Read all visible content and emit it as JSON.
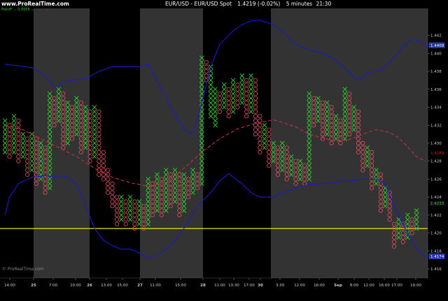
{
  "header": {
    "brand": "www.ProRealTime.com",
    "title": "EUR/USD - EUR/USD Spot",
    "price": "1.4219 (-0.02%)",
    "interval": "5 minutes",
    "time": "21:30"
  },
  "legend": {
    "line1": "PointF ... 0.0005 ...",
    "line2": "...",
    "line3": "..."
  },
  "watermark": "© ProRealTime.com",
  "colors": {
    "background": "#000000",
    "session_band": "#333333",
    "x_mark": "#33cc33",
    "o_mark": "#e05060",
    "upper_band": "#1a1acc",
    "lower_band": "#1a1acc",
    "middle_line": "#c03040",
    "level_line": "#e8e000",
    "axis_text": "#cccccc",
    "current_price_label": "#cc2222"
  },
  "chart_data": {
    "type": "point-and-figure",
    "symbol": "EUR/USD",
    "box_size": 0.0005,
    "ylim": [
      1.415,
      1.445
    ],
    "y_ticks": [
      "1.442",
      "1.440",
      "1.438",
      "1.436",
      "1.434",
      "1.432",
      "1.430",
      "1.428",
      "1.426",
      "1.424",
      "1.422",
      "1.420",
      "1.418",
      "1.416"
    ],
    "x_labels": [
      "14:00",
      "25",
      "7:00",
      "10:00",
      "26",
      "13:00",
      "15:00",
      "27",
      "11:00",
      "15:00",
      "28",
      "11:00",
      "13:30",
      "17:00",
      "30",
      "3:30",
      "12:00",
      "16:00",
      "Sep",
      "8:00",
      "12:00",
      "16:00",
      "17:00",
      "19:00"
    ],
    "horizontal_level": 1.4205,
    "price_labels": {
      "upper": "1.4409",
      "middle": "1.4289",
      "lower_mid": "1.4233",
      "lower": "1.4174"
    },
    "columns": [
      {
        "type": "X",
        "low": 1.429,
        "high": 1.4325
      },
      {
        "type": "O",
        "low": 1.4285,
        "high": 1.432
      },
      {
        "type": "X",
        "low": 1.429,
        "high": 1.433
      },
      {
        "type": "O",
        "low": 1.428,
        "high": 1.4325
      },
      {
        "type": "X",
        "low": 1.4285,
        "high": 1.431
      },
      {
        "type": "O",
        "low": 1.4265,
        "high": 1.4305
      },
      {
        "type": "X",
        "low": 1.427,
        "high": 1.431
      },
      {
        "type": "O",
        "low": 1.4255,
        "high": 1.4305
      },
      {
        "type": "X",
        "low": 1.426,
        "high": 1.43
      },
      {
        "type": "O",
        "low": 1.4245,
        "high": 1.4295
      },
      {
        "type": "X",
        "low": 1.425,
        "high": 1.4355
      },
      {
        "type": "O",
        "low": 1.432,
        "high": 1.435
      },
      {
        "type": "X",
        "low": 1.4325,
        "high": 1.436
      },
      {
        "type": "O",
        "low": 1.4295,
        "high": 1.4355
      },
      {
        "type": "X",
        "low": 1.43,
        "high": 1.4345
      },
      {
        "type": "O",
        "low": 1.4305,
        "high": 1.434
      },
      {
        "type": "X",
        "low": 1.431,
        "high": 1.435
      },
      {
        "type": "O",
        "low": 1.429,
        "high": 1.4345
      },
      {
        "type": "X",
        "low": 1.4295,
        "high": 1.434
      },
      {
        "type": "O",
        "low": 1.428,
        "high": 1.4335
      },
      {
        "type": "X",
        "low": 1.4285,
        "high": 1.434
      },
      {
        "type": "O",
        "low": 1.4265,
        "high": 1.4335
      },
      {
        "type": "O",
        "low": 1.426,
        "high": 1.429
      },
      {
        "type": "O",
        "low": 1.4245,
        "high": 1.427
      },
      {
        "type": "O",
        "low": 1.423,
        "high": 1.4255
      },
      {
        "type": "O",
        "low": 1.421,
        "high": 1.424
      },
      {
        "type": "X",
        "low": 1.4215,
        "high": 1.424
      },
      {
        "type": "O",
        "low": 1.421,
        "high": 1.4235
      },
      {
        "type": "X",
        "low": 1.4215,
        "high": 1.424
      },
      {
        "type": "O",
        "low": 1.4205,
        "high": 1.4235
      },
      {
        "type": "X",
        "low": 1.421,
        "high": 1.4235
      },
      {
        "type": "O",
        "low": 1.4205,
        "high": 1.423
      },
      {
        "type": "X",
        "low": 1.421,
        "high": 1.426
      },
      {
        "type": "O",
        "low": 1.422,
        "high": 1.4255
      },
      {
        "type": "X",
        "low": 1.4225,
        "high": 1.4265
      },
      {
        "type": "O",
        "low": 1.422,
        "high": 1.426
      },
      {
        "type": "X",
        "low": 1.4225,
        "high": 1.427
      },
      {
        "type": "O",
        "low": 1.423,
        "high": 1.4265
      },
      {
        "type": "X",
        "low": 1.4235,
        "high": 1.427
      },
      {
        "type": "O",
        "low": 1.422,
        "high": 1.4265
      },
      {
        "type": "X",
        "low": 1.4225,
        "high": 1.4265
      },
      {
        "type": "O",
        "low": 1.424,
        "high": 1.426
      },
      {
        "type": "X",
        "low": 1.4245,
        "high": 1.427
      },
      {
        "type": "O",
        "low": 1.425,
        "high": 1.4265
      },
      {
        "type": "X",
        "low": 1.4255,
        "high": 1.4395
      },
      {
        "type": "O",
        "low": 1.437,
        "high": 1.439
      },
      {
        "type": "X",
        "low": 1.433,
        "high": 1.4385
      },
      {
        "type": "X",
        "low": 1.432,
        "high": 1.436
      },
      {
        "type": "O",
        "low": 1.4335,
        "high": 1.4355
      },
      {
        "type": "X",
        "low": 1.434,
        "high": 1.4365
      },
      {
        "type": "O",
        "low": 1.433,
        "high": 1.436
      },
      {
        "type": "X",
        "low": 1.4335,
        "high": 1.437
      },
      {
        "type": "O",
        "low": 1.434,
        "high": 1.4365
      },
      {
        "type": "X",
        "low": 1.4345,
        "high": 1.4375
      },
      {
        "type": "O",
        "low": 1.433,
        "high": 1.437
      },
      {
        "type": "X",
        "low": 1.4335,
        "high": 1.4375
      },
      {
        "type": "O",
        "low": 1.431,
        "high": 1.437
      },
      {
        "type": "O",
        "low": 1.429,
        "high": 1.433
      },
      {
        "type": "X",
        "low": 1.4295,
        "high": 1.432
      },
      {
        "type": "O",
        "low": 1.4275,
        "high": 1.4315
      },
      {
        "type": "X",
        "low": 1.428,
        "high": 1.43
      },
      {
        "type": "O",
        "low": 1.4265,
        "high": 1.4295
      },
      {
        "type": "X",
        "low": 1.427,
        "high": 1.43
      },
      {
        "type": "O",
        "low": 1.426,
        "high": 1.4295
      },
      {
        "type": "X",
        "low": 1.4265,
        "high": 1.4285
      },
      {
        "type": "O",
        "low": 1.4255,
        "high": 1.428
      },
      {
        "type": "X",
        "low": 1.426,
        "high": 1.428
      },
      {
        "type": "O",
        "low": 1.4255,
        "high": 1.4275
      },
      {
        "type": "X",
        "low": 1.426,
        "high": 1.4355
      },
      {
        "type": "O",
        "low": 1.432,
        "high": 1.435
      },
      {
        "type": "X",
        "low": 1.4325,
        "high": 1.435
      },
      {
        "type": "O",
        "low": 1.4305,
        "high": 1.4345
      },
      {
        "type": "X",
        "low": 1.431,
        "high": 1.4345
      },
      {
        "type": "O",
        "low": 1.43,
        "high": 1.434
      },
      {
        "type": "X",
        "low": 1.4305,
        "high": 1.433
      },
      {
        "type": "O",
        "low": 1.43,
        "high": 1.4325
      },
      {
        "type": "X",
        "low": 1.4305,
        "high": 1.436
      },
      {
        "type": "O",
        "low": 1.431,
        "high": 1.4355
      },
      {
        "type": "X",
        "low": 1.4315,
        "high": 1.434
      },
      {
        "type": "O",
        "low": 1.429,
        "high": 1.4335
      },
      {
        "type": "O",
        "low": 1.427,
        "high": 1.43
      },
      {
        "type": "X",
        "low": 1.4275,
        "high": 1.4295
      },
      {
        "type": "O",
        "low": 1.425,
        "high": 1.429
      },
      {
        "type": "X",
        "low": 1.4255,
        "high": 1.427
      },
      {
        "type": "O",
        "low": 1.4225,
        "high": 1.4265
      },
      {
        "type": "X",
        "low": 1.423,
        "high": 1.425
      },
      {
        "type": "O",
        "low": 1.4215,
        "high": 1.4245
      },
      {
        "type": "O",
        "low": 1.4185,
        "high": 1.421
      },
      {
        "type": "X",
        "low": 1.4195,
        "high": 1.4215
      },
      {
        "type": "O",
        "low": 1.419,
        "high": 1.421
      },
      {
        "type": "X",
        "low": 1.4195,
        "high": 1.422
      },
      {
        "type": "O",
        "low": 1.42,
        "high": 1.4215
      },
      {
        "type": "X",
        "low": 1.4205,
        "high": 1.4225
      }
    ],
    "session_bands": [
      {
        "from_col": 0,
        "to_col": 7,
        "shade": "dark"
      },
      {
        "from_col": 8,
        "to_col": 20,
        "shade": "grey"
      },
      {
        "from_col": 21,
        "to_col": 31,
        "shade": "dark"
      },
      {
        "from_col": 32,
        "to_col": 46,
        "shade": "grey"
      },
      {
        "from_col": 47,
        "to_col": 60,
        "shade": "dark"
      },
      {
        "from_col": 61,
        "to_col": 92,
        "shade": "grey"
      }
    ],
    "series": [
      {
        "key": "upper_band",
        "points": [
          [
            0,
            1.4388
          ],
          [
            3,
            1.4386
          ],
          [
            6,
            1.4384
          ],
          [
            9,
            1.4375
          ],
          [
            11,
            1.4362
          ],
          [
            13,
            1.4368
          ],
          [
            15,
            1.437
          ],
          [
            18,
            1.4372
          ],
          [
            21,
            1.438
          ],
          [
            24,
            1.4385
          ],
          [
            27,
            1.4385
          ],
          [
            30,
            1.4385
          ],
          [
            32,
            1.4388
          ],
          [
            34,
            1.437
          ],
          [
            37,
            1.434
          ],
          [
            40,
            1.4315
          ],
          [
            42,
            1.431
          ],
          [
            44,
            1.4345
          ],
          [
            46,
            1.4385
          ],
          [
            48,
            1.441
          ],
          [
            51,
            1.4425
          ],
          [
            53,
            1.4432
          ],
          [
            55,
            1.4436
          ],
          [
            57,
            1.4437
          ],
          [
            60,
            1.4432
          ],
          [
            62,
            1.4425
          ],
          [
            65,
            1.441
          ],
          [
            68,
            1.4404
          ],
          [
            71,
            1.44
          ],
          [
            74,
            1.4392
          ],
          [
            77,
            1.4378
          ],
          [
            79,
            1.437
          ],
          [
            81,
            1.4378
          ],
          [
            84,
            1.4382
          ],
          [
            87,
            1.4395
          ],
          [
            89,
            1.4408
          ],
          [
            91,
            1.4416
          ],
          [
            93,
            1.4413
          ],
          [
            95,
            1.4405
          ]
        ]
      },
      {
        "key": "middle_line",
        "points": [
          [
            0,
            1.432
          ],
          [
            4,
            1.4315
          ],
          [
            8,
            1.4305
          ],
          [
            12,
            1.4295
          ],
          [
            16,
            1.4285
          ],
          [
            20,
            1.4272
          ],
          [
            24,
            1.4262
          ],
          [
            28,
            1.4256
          ],
          [
            32,
            1.4252
          ],
          [
            36,
            1.4256
          ],
          [
            40,
            1.4272
          ],
          [
            44,
            1.429
          ],
          [
            48,
            1.4305
          ],
          [
            52,
            1.4316
          ],
          [
            56,
            1.4322
          ],
          [
            60,
            1.4326
          ],
          [
            62,
            1.4323
          ],
          [
            65,
            1.4318
          ],
          [
            68,
            1.431
          ],
          [
            71,
            1.4306
          ],
          [
            74,
            1.4302
          ],
          [
            77,
            1.4304
          ],
          [
            80,
            1.431
          ],
          [
            83,
            1.4315
          ],
          [
            86,
            1.4312
          ],
          [
            88,
            1.4306
          ],
          [
            90,
            1.4296
          ],
          [
            92,
            1.4285
          ],
          [
            94,
            1.428
          ]
        ]
      },
      {
        "key": "lower_band",
        "points": [
          [
            0,
            1.422
          ],
          [
            1,
            1.424
          ],
          [
            3,
            1.4255
          ],
          [
            6,
            1.4262
          ],
          [
            9,
            1.4264
          ],
          [
            12,
            1.4262
          ],
          [
            14,
            1.4262
          ],
          [
            16,
            1.4255
          ],
          [
            18,
            1.423
          ],
          [
            20,
            1.4205
          ],
          [
            22,
            1.4192
          ],
          [
            24,
            1.4186
          ],
          [
            26,
            1.4182
          ],
          [
            28,
            1.4182
          ],
          [
            30,
            1.4178
          ],
          [
            32,
            1.4172
          ],
          [
            34,
            1.4175
          ],
          [
            37,
            1.4186
          ],
          [
            40,
            1.4205
          ],
          [
            43,
            1.423
          ],
          [
            46,
            1.4245
          ],
          [
            48,
            1.4258
          ],
          [
            50,
            1.4266
          ],
          [
            53,
            1.4255
          ],
          [
            55,
            1.4245
          ],
          [
            57,
            1.424
          ],
          [
            60,
            1.424
          ],
          [
            62,
            1.4245
          ],
          [
            65,
            1.425
          ],
          [
            68,
            1.4254
          ],
          [
            71,
            1.4255
          ],
          [
            74,
            1.4257
          ],
          [
            77,
            1.4258
          ],
          [
            80,
            1.426
          ],
          [
            83,
            1.426
          ],
          [
            85,
            1.4255
          ],
          [
            87,
            1.423
          ],
          [
            89,
            1.421
          ],
          [
            91,
            1.419
          ],
          [
            93,
            1.4178
          ],
          [
            95,
            1.417
          ]
        ]
      }
    ]
  }
}
